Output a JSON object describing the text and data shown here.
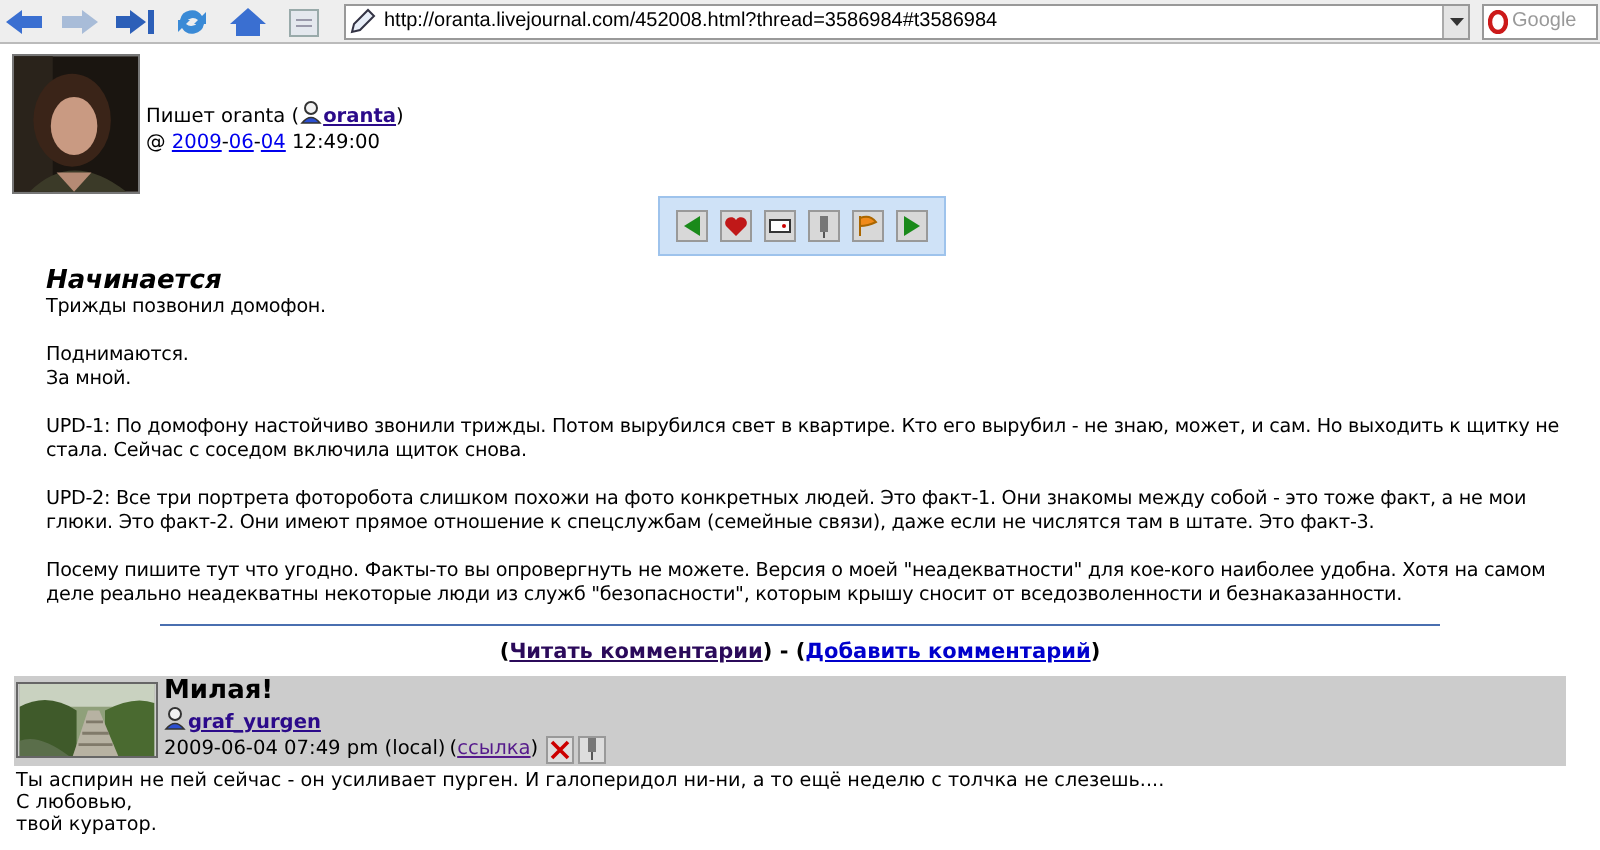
{
  "browser": {
    "url": "http://oranta.livejournal.com/452008.html?thread=3586984#t3586984",
    "search_placeholder": "Google"
  },
  "post": {
    "author_prefix": "Пишет oranta (",
    "author_user": "oranta",
    "author_suffix": ")",
    "date_at": "@",
    "date_parts": [
      "2009",
      "06",
      "04"
    ],
    "date_separator": "-",
    "time": "12:49:00",
    "title": "Начинается",
    "paragraphs": [
      "Трижды позвонил домофон.",
      "Поднимаются.\nЗа мной.",
      "UPD-1: По домофону настойчиво звонили трижды. Потом вырубился свет в квартире. Кто его вырубил - не знаю, может, и сам. Но выходить к щитку не стала. Сейчас с соседом включила щиток снова.",
      "UPD-2: Все три портрета фоторобота слишком похожи на фото конкретных людей. Это факт-1. Они знакомы между собой - это тоже факт, а не мои глюки. Это факт-2. Они имеют прямое отношение к спецслужбам (семейные связи), даже если не числятся там в штате. Это факт-3.",
      "Посему пишите тут что угодно. Факты-то вы опровергнуть не можете. Версия о моей \"неадекватности\" для кое-кого наиболее удобна. Хотя на самом деле реально неадекватны некоторые люди из служб \"безопасности\", которым крышу сносит от вседозволенности и безнаказанности."
    ]
  },
  "comment_links": {
    "open": "(",
    "read": "Читать комментарии",
    "middle": ") - (",
    "add": "Добавить комментарий",
    "close": ")"
  },
  "comment": {
    "subject": "Милая!",
    "user": "graf_yurgen",
    "date": "2009-06-04 07:49 pm (local)",
    "link_open": "(",
    "link": "ссылка",
    "link_close": ")",
    "body": "Ты аспирин не пей сейчас - он усиливает пурген. И галоперидол ни-ни, а то ещё неделю с толчка не слезешь....\nС любовью,\nтвой куратор."
  }
}
